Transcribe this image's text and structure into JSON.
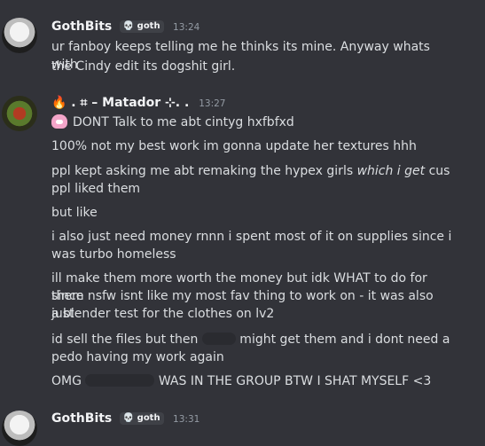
{
  "messages": [
    {
      "author": "GothBits",
      "tag": "goth",
      "time": "13:24",
      "lines": [
        "ur fanboy keeps telling me he thinks its mine. Anyway whats with",
        "the Cindy edit its dogshit girl."
      ]
    },
    {
      "author_prefix": "🔥 . ⌗ – ",
      "author": "Matador",
      "author_suffix": "⊹. .",
      "time": "13:27",
      "lines": [
        "DONT Talk to me abt cintyg hxfbfxd",
        "100% not my best work im gonna update her textures hhh",
        "ppl kept asking me abt remaking the hypex girls ",
        "which i get",
        " cus",
        "ppl liked them",
        "but like",
        "i also just need money rnnn i spent most of it on supplies since i",
        "was turbo homeless",
        "ill make them more worth the money but idk WHAT to do for them",
        "since nsfw isnt like my most fav thing to work on - it was also just",
        "a blender test for the clothes on lv2",
        "id sell the files but then ",
        " might get them and i dont need a",
        "pedo having my work again",
        "OMG ",
        " WAS IN THE GROUP BTW I SHAT MYSELF <3"
      ]
    },
    {
      "author": "GothBits",
      "tag": "goth",
      "time": "13:31"
    }
  ]
}
